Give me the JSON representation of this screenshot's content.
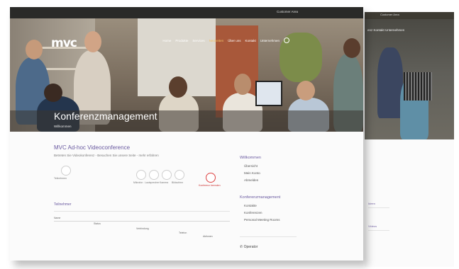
{
  "back": {
    "top_link": "Customer Area",
    "nav": "enz  Kontakt  Unternehmen",
    "links": [
      "Ideen",
      "Videos"
    ]
  },
  "front": {
    "top_link": "Customer Area",
    "logo": "mvc",
    "nav": [
      "Home",
      "Produkte",
      "Services",
      "Neuheiten",
      "Über uns",
      "Kontakt",
      "Unternehmen"
    ],
    "hero_title": "Konferenzmanagement",
    "hero_sub": "Willkommen",
    "card": {
      "title": "MVC Ad-hoc Videoconference",
      "desc": "Betreten Sie Videokonferenz - Besuchen Sie unsere Seite - mehr erfahren",
      "join_label": "Teilnehmen",
      "icons": [
        "Mikrofon",
        "Lautsprecher",
        "Kamera",
        "Bildschirm"
      ],
      "end_label": "Konferenz beenden"
    },
    "section": "Teilnehmer",
    "table_headers": [
      "Name",
      "Status",
      "Verbindung",
      "Telefon",
      "Aktionen"
    ],
    "sidebar": {
      "group1_title": "Willkommen",
      "group1_items": [
        "Übersicht",
        "Mein Konto",
        "Abmelden"
      ],
      "group2_title": "Konferenzmanagement",
      "group2_items": [
        "Kontakte",
        "Konferenzen",
        "Personal Meeting Rooms"
      ]
    },
    "phone": "Operator"
  }
}
